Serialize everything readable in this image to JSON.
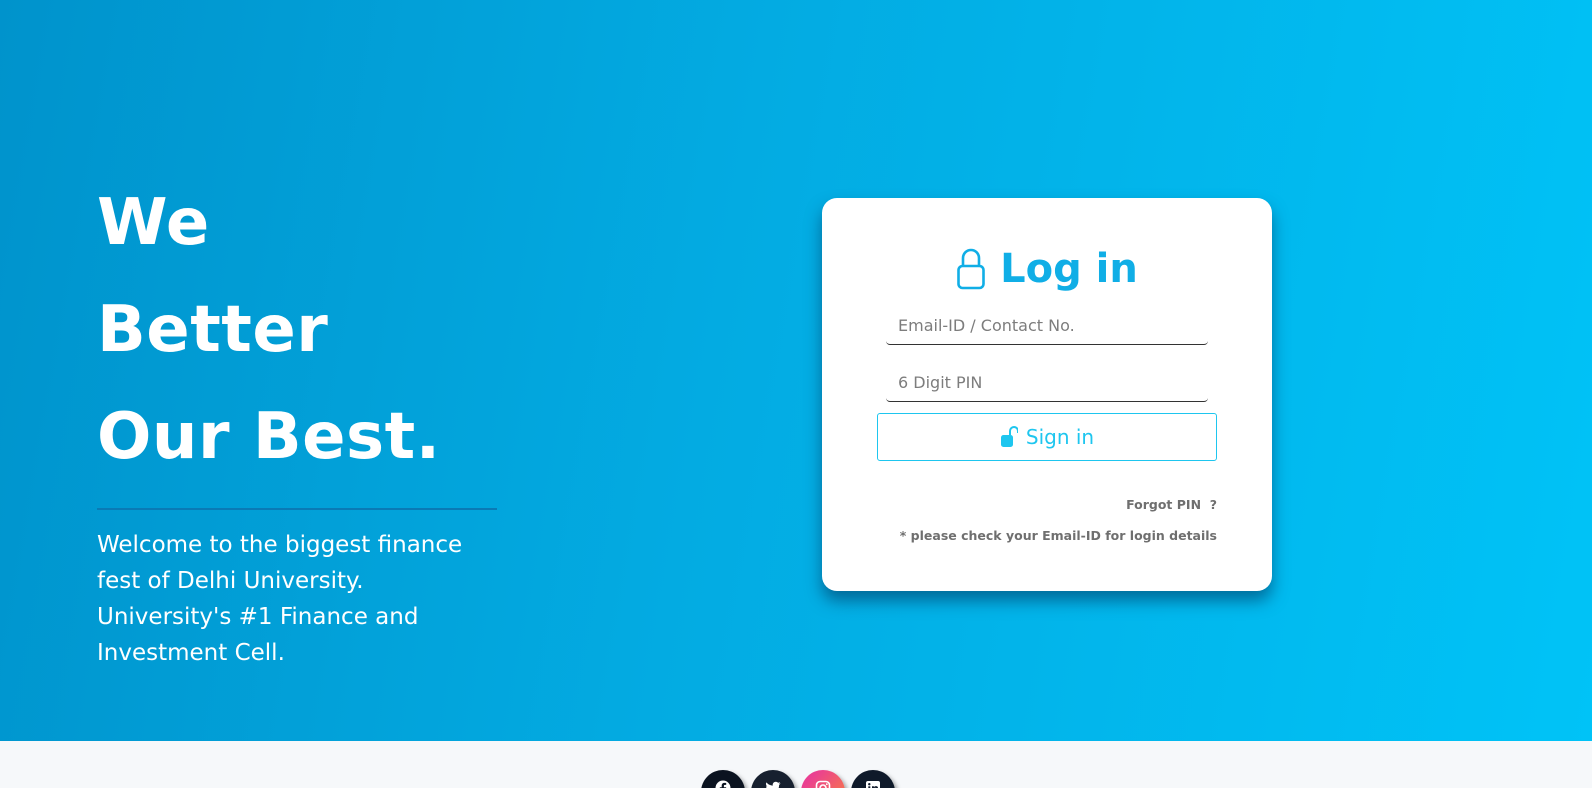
{
  "hero": {
    "tagline_lines": [
      "We",
      "Better",
      "Our Best."
    ],
    "welcome_text": "Welcome to the biggest finance fest of Delhi University. University's #1 Finance and Investment Cell."
  },
  "login": {
    "title": "Log in",
    "title_icon": "lock-icon",
    "email_placeholder": "Email-ID / Contact No.",
    "pin_placeholder": "6 Digit PIN",
    "signin_label": "Sign in",
    "signin_icon": "unlock-icon",
    "forgot_label": "Forgot PIN  ?",
    "note": "* please check your Email-ID for login details"
  },
  "footer": {
    "social": [
      "facebook-icon",
      "twitter-icon",
      "instagram-icon",
      "linkedin-icon"
    ]
  },
  "colors": {
    "accent": "#10aee6",
    "button_accent": "#1ec6ef",
    "hero_gradient_start": "#0093cc",
    "hero_gradient_end": "#00c3f7",
    "muted_text": "#6f6f6f"
  }
}
